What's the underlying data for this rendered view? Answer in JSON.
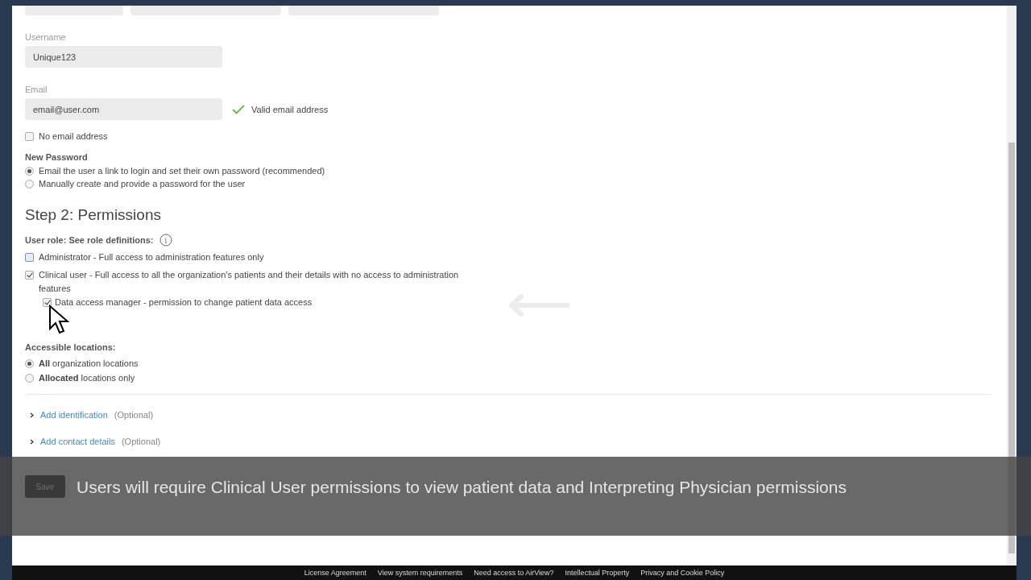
{
  "username": {
    "label": "Username",
    "value": "Unique123"
  },
  "email": {
    "label": "Email",
    "value": "email@user.com",
    "validation": "Valid email address"
  },
  "no_email": {
    "label": "No email address",
    "checked": false
  },
  "new_password": {
    "label": "New Password",
    "options": [
      {
        "label": "Email the user a link to login and set their own password (recommended)",
        "selected": true
      },
      {
        "label": "Manually create and provide a password for the user",
        "selected": false
      }
    ]
  },
  "step2": {
    "heading": "Step 2: Permissions"
  },
  "user_role": {
    "label": "User role: See role definitions:",
    "info_icon": "i",
    "roles": [
      {
        "label": "Administrator - Full access to administration features only",
        "checked": false,
        "focused": true
      },
      {
        "label": "Clinical user - Full access to all the organization's patients and their details with no access to administration features",
        "checked": true,
        "focused": false,
        "children": [
          {
            "label": "Data access manager - permission to change patient data access",
            "checked": true,
            "focused": false
          }
        ]
      }
    ]
  },
  "locations": {
    "label": "Accessible locations:",
    "options": [
      {
        "label": "**All** organization locations",
        "selected": true
      },
      {
        "label": "**Allocated** locations only",
        "selected": false
      }
    ]
  },
  "expanders": [
    {
      "link": "Add identification",
      "note": "(Optional)"
    },
    {
      "link": "Add contact details",
      "note": "(Optional)"
    }
  ],
  "save_button": "Save",
  "caption": "Users will require Clinical User permissions to view patient data and Interpreting Physician permissions",
  "footer_links": [
    "License Agreement",
    "View system requirements",
    "Need access to AirView?",
    "Intellectual Property",
    "Privacy and Cookie Policy"
  ]
}
